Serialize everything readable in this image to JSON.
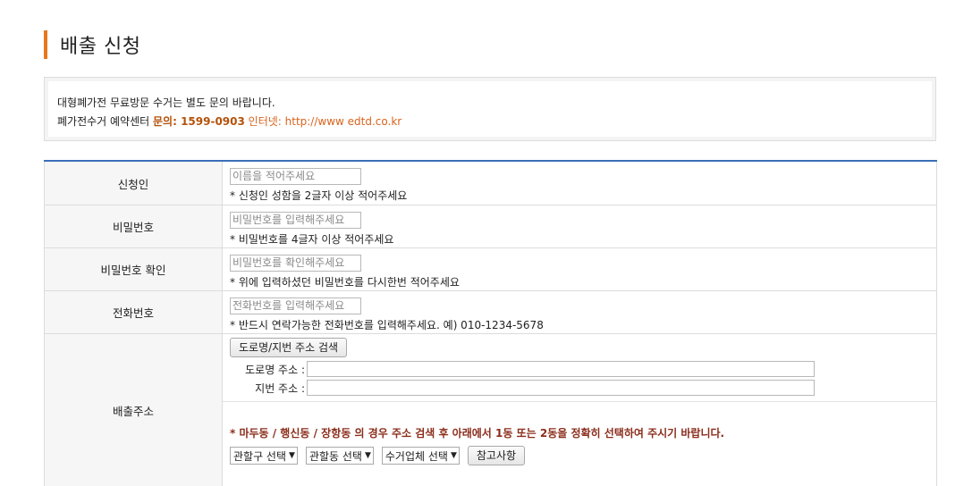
{
  "page_title": "배출 신청",
  "notice": {
    "line1": "대형폐가전 무료방문 수거는 별도 문의 바랍니다.",
    "line2_prefix": "폐가전수거 예약센터 ",
    "inquiry_label": "문의: ",
    "inquiry_number": "1599-0903",
    "internet": " 인터넷: http://www edtd.co.kr"
  },
  "form": {
    "applicant": {
      "label": "신청인",
      "placeholder": "이름을 적어주세요",
      "help": "* 신청인 성함을 2글자 이상 적어주세요"
    },
    "password": {
      "label": "비밀번호",
      "placeholder": "비밀번호를 입력해주세요",
      "help": "* 비밀번호를 4글자 이상 적어주세요"
    },
    "password_confirm": {
      "label": "비밀번호 확인",
      "placeholder": "비밀번호를 확인해주세요",
      "help": "* 위에 입력하셨던 비밀번호를 다시한번 적어주세요"
    },
    "phone": {
      "label": "전화번호",
      "placeholder": "전화번호를 입력해주세요",
      "help": "* 반드시 연락가능한 전화번호를 입력해주세요. 예) 010-1234-5678"
    },
    "address": {
      "label": "배출주소",
      "search_button": "도로명/지번 주소 검색",
      "road_label": "도로명 주소 :",
      "lot_label": "지번 주소 :",
      "road_value": "",
      "lot_value": "",
      "warning": "* 마두동 / 행신동 / 장항동 의 경우 주소 검색 후 아래에서 1동 또는 2동을 정확히 선택하여 주시기 바랍니다.",
      "district_select": "관할구 선택",
      "dong_select": "관할동 선택",
      "company_select": "수거업체 선택",
      "reference_button": "참고사항"
    }
  },
  "colors": {
    "accent": "#e8771f",
    "table_top": "#3a6fb8",
    "warning": "#8b2d1b"
  }
}
